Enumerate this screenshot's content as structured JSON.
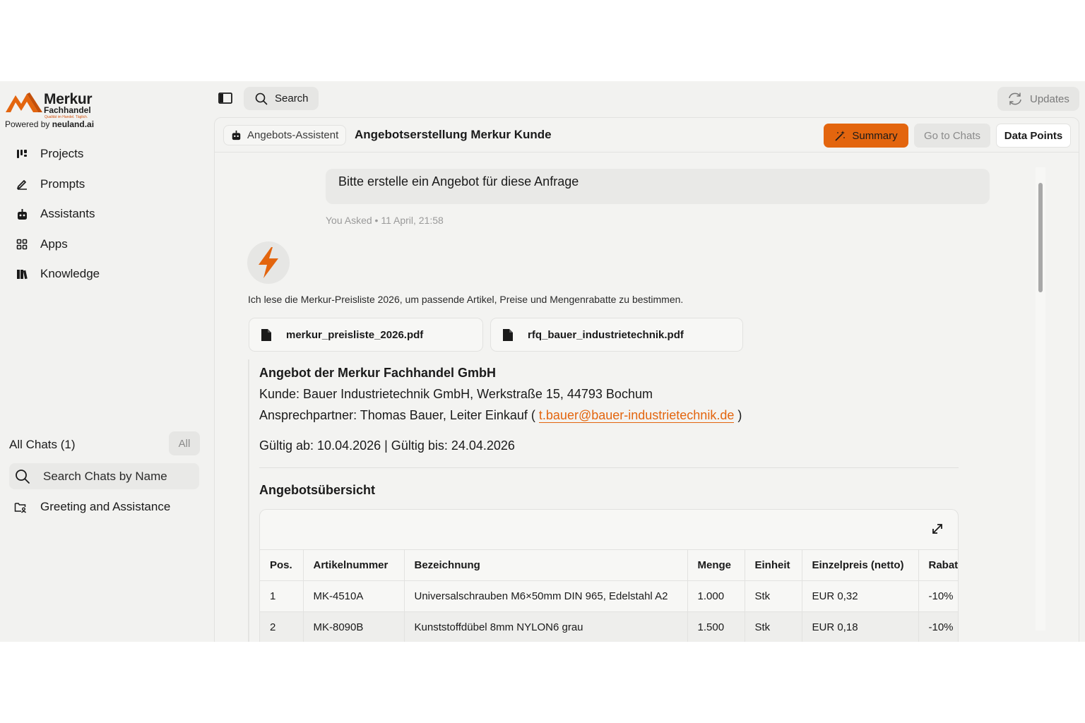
{
  "brand": {
    "name": "Merkur",
    "sub": "Fachhandel",
    "tagline": "Qualität im Handel. Täglich.",
    "powered_prefix": "Powered by",
    "powered_by": "neuland.ai",
    "accent_color": "#e3650e"
  },
  "sidebar": {
    "nav": [
      {
        "label": "Projects",
        "icon": "projects-icon"
      },
      {
        "label": "Prompts",
        "icon": "pen-icon"
      },
      {
        "label": "Assistants",
        "icon": "robot-icon"
      },
      {
        "label": "Apps",
        "icon": "grid-icon"
      },
      {
        "label": "Knowledge",
        "icon": "books-icon"
      }
    ],
    "chats_title": "All Chats (1)",
    "chats_filter": "All",
    "chat_search_placeholder": "Search Chats by Name",
    "chats": [
      {
        "label": "Greeting and Assistance",
        "icon": "folder-user-icon"
      }
    ]
  },
  "topbar": {
    "search_label": "Search",
    "updates_label": "Updates"
  },
  "header": {
    "assistant_label": "Angebots-Assistent",
    "title": "Angebotserstellung Merkur Kunde",
    "summary_label": "Summary",
    "go_to_chats_label": "Go to Chats",
    "data_points_label": "Data Points"
  },
  "conversation": {
    "user_message": "Bitte erstelle ein Angebot für diese Anfrage",
    "asked_meta": "You Asked • 11 April, 21:58",
    "assistant_status": "Ich lese die Merkur-Preisliste 2026, um passende Artikel, Preise und Mengenrabatte zu bestimmen.",
    "files": [
      {
        "name": "merkur_preisliste_2026.pdf"
      },
      {
        "name": "rfq_bauer_industrietechnik.pdf"
      }
    ],
    "answer": {
      "title": "Angebot der Merkur Fachhandel GmbH",
      "customer": "Kunde: Bauer Industrietechnik GmbH, Werkstraße 15, 44793 Bochum",
      "contact_prefix": "Ansprechpartner: Thomas Bauer, Leiter Einkauf (",
      "contact_email": "t.bauer@bauer-industrietechnik.de",
      "contact_suffix": ")",
      "validity": "Gültig ab: 10.04.2026 | Gültig bis: 24.04.2026",
      "overview_heading": "Angebotsübersicht",
      "table": {
        "columns": [
          "Pos.",
          "Artikelnummer",
          "Bezeichnung",
          "Menge",
          "Einheit",
          "Einzelpreis (netto)",
          "Rabatt"
        ],
        "rows": [
          [
            "1",
            "MK-4510A",
            "Universalschrauben M6×50mm DIN 965, Edelstahl A2",
            "1.000",
            "Stk",
            "EUR 0,32",
            "-10%"
          ],
          [
            "2",
            "MK-8090B",
            "Kunststoffdübel 8mm NYLON6 grau",
            "1.500",
            "Stk",
            "EUR 0,18",
            "-10%"
          ]
        ]
      }
    }
  }
}
